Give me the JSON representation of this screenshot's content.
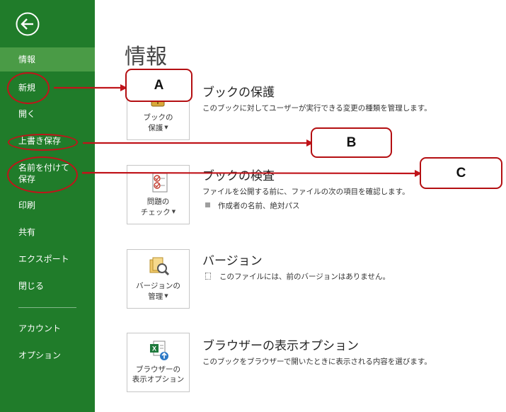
{
  "sidebar": {
    "back_icon": "back-arrow-icon",
    "items": [
      {
        "id": "info",
        "label": "情報",
        "active": true
      },
      {
        "id": "new",
        "label": "新規"
      },
      {
        "id": "open",
        "label": "開く"
      },
      {
        "id": "save",
        "label": "上書き保存"
      },
      {
        "id": "save-as",
        "label": "名前を付けて\n保存"
      },
      {
        "id": "print",
        "label": "印刷"
      },
      {
        "id": "share",
        "label": "共有"
      },
      {
        "id": "export",
        "label": "エクスポート"
      },
      {
        "id": "close",
        "label": "閉じる"
      },
      {
        "id": "account",
        "label": "アカウント"
      },
      {
        "id": "options",
        "label": "オプション"
      }
    ]
  },
  "main": {
    "title": "情報",
    "sections": [
      {
        "button_label": "ブックの\n保護",
        "title": "ブックの保護",
        "description": "このブックに対してユーザーが実行できる変更の種類を管理します。",
        "icon": "key-lock-icon"
      },
      {
        "button_label": "問題の\nチェック",
        "title": "ブックの検査",
        "description": "ファイルを公開する前に、ファイルの次の項目を確認します。",
        "bullets": [
          "作成者の名前、絶対パス"
        ],
        "icon": "checklist-icon"
      },
      {
        "button_label": "バージョンの\n管理",
        "title": "バージョン",
        "description": "このファイルには、前のバージョンはありません。",
        "icon": "versions-magnifier-icon"
      },
      {
        "button_label": "ブラウザーの\n表示オプション",
        "title": "ブラウザーの表示オプション",
        "description": "このブックをブラウザーで開いたときに表示される内容を選びます。",
        "icon": "excel-upload-icon"
      }
    ]
  },
  "annotations": {
    "callout_a": "A",
    "callout_b": "B",
    "callout_c": "C",
    "accent_color": "#b40f12"
  },
  "colors": {
    "sidebar_bg": "#207c2a",
    "sidebar_active": "#4a9b46"
  }
}
